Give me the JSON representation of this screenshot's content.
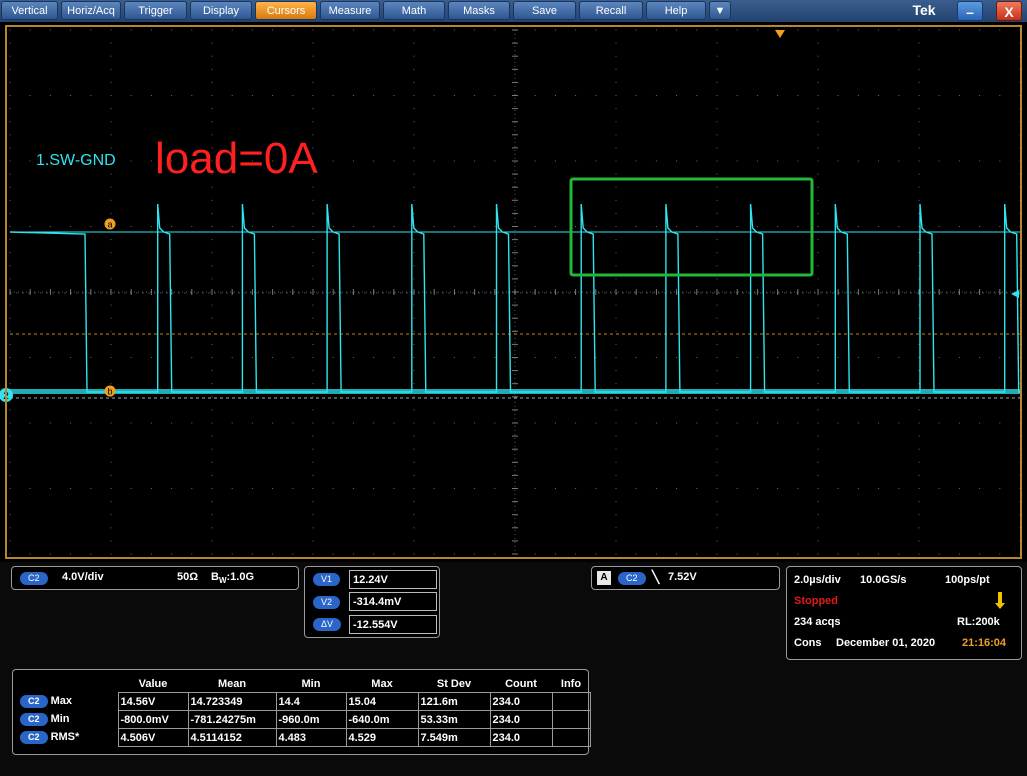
{
  "menu": {
    "items": [
      "Vertical",
      "Horiz/Acq",
      "Trigger",
      "Display",
      "Cursors",
      "Measure",
      "Math",
      "Masks",
      "Save",
      "Recall",
      "Help",
      "▼"
    ],
    "active": "Cursors",
    "brand": "Tek",
    "minimize": "–",
    "close": "X"
  },
  "screen": {
    "channel_label": "1.SW-GND",
    "annotation": "load=0A",
    "cursor_a_label": "a",
    "cursor_b_label": "b",
    "ch2_marker": "2",
    "trace_color": "#2fe4ef",
    "frame_color": "#b8862e",
    "highlight_color": "#22b83a"
  },
  "vertical": {
    "channel": "C2",
    "scale": "4.0V/div",
    "termination": "50Ω",
    "bw_prefix": "B",
    "bw_sub": "W",
    "bw_value": ":1.0G"
  },
  "cursors": {
    "v1_label": "V1",
    "v1": "12.24V",
    "v2_label": "V2",
    "v2": "-314.4mV",
    "dv_label": "ΔV",
    "dv": "-12.554V"
  },
  "trigger": {
    "mode": "A",
    "channel": "C2",
    "slope": "╲",
    "level": "7.52V"
  },
  "acquisition": {
    "timebase": "2.0µs/div",
    "sample_rate": "10.0GS/s",
    "resolution": "100ps/pt",
    "state": "Stopped",
    "acqs": "234 acqs",
    "record_length": "RL:200k",
    "mode": "Cons",
    "date": "December 01, 2020",
    "time": "21:16:04"
  },
  "measurements": {
    "headers": [
      "",
      "Value",
      "Mean",
      "Min",
      "Max",
      "St Dev",
      "Count",
      "Info"
    ],
    "rows": [
      {
        "channel": "C2",
        "name": "Max",
        "value": "14.56V",
        "mean": "14.723349",
        "min": "14.4",
        "max": "15.04",
        "stdev": "121.6m",
        "count": "234.0",
        "info": ""
      },
      {
        "channel": "C2",
        "name": "Min",
        "value": "-800.0mV",
        "mean": "-781.24275m",
        "min": "-960.0m",
        "max": "-640.0m",
        "stdev": "53.33m",
        "count": "234.0",
        "info": ""
      },
      {
        "channel": "C2",
        "name": "RMS*",
        "value": "4.506V",
        "mean": "4.5114152",
        "min": "4.483",
        "max": "4.529",
        "stdev": "7.549m",
        "count": "234.0",
        "info": ""
      }
    ]
  }
}
